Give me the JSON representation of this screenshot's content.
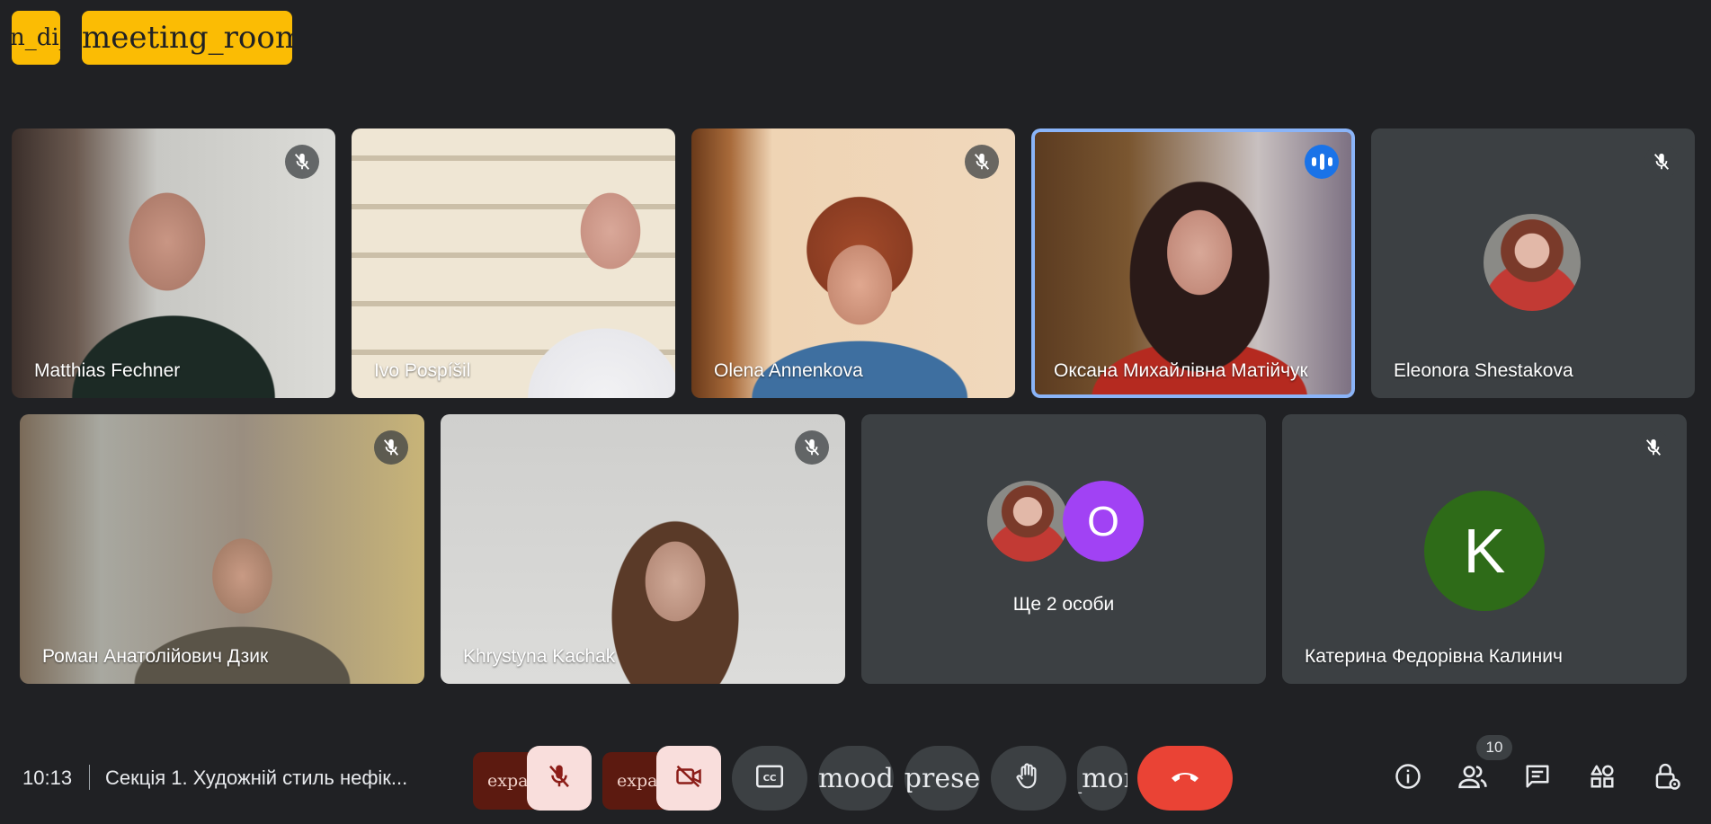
{
  "top_chips": {
    "left_label": "n_di_bled",
    "right_label": "meeting_room"
  },
  "participants": [
    {
      "name": "Matthias Fechner",
      "muted": true
    },
    {
      "name": "Ivo Pospíšil",
      "muted": false
    },
    {
      "name": "Olena Annenkova",
      "muted": true
    },
    {
      "name": "Оксана Михайлівна Матійчук",
      "speaking": true
    },
    {
      "name": "Eleonora Shestakova",
      "muted": true
    },
    {
      "name": "Роман Анатолійович Дзик",
      "muted": true
    },
    {
      "name": "Khrystyna Kachak",
      "muted": true
    },
    {
      "group_label": "Ще 2 особи",
      "avatar_letter": "O"
    },
    {
      "name": "Катерина Федорівна Калинич",
      "muted": true,
      "avatar_letter": "K"
    }
  ],
  "bottom_bar": {
    "time": "10:13",
    "meeting_title": "Секція 1. Художній стиль нефік...",
    "mic_expand_label": "expa",
    "cam_expand_label": "expa",
    "mood_label": "mood",
    "present_label": "prese",
    "more_label": "_mor",
    "participants_count": "10"
  },
  "colors": {
    "background": "#202124",
    "tile": "#3c4043",
    "accent_blue": "#1a73e8",
    "hangup_red": "#ea4335",
    "chip_yellow": "#fbbc04",
    "avatar_purple": "#a142f4",
    "avatar_green": "#2e6b18"
  },
  "icons": [
    "mic-off-icon",
    "audio-level-icon",
    "cam-off-icon",
    "captions-icon",
    "hand-icon",
    "call-end-icon",
    "info-icon",
    "people-icon",
    "chat-icon",
    "activities-icon",
    "host-controls-icon"
  ]
}
